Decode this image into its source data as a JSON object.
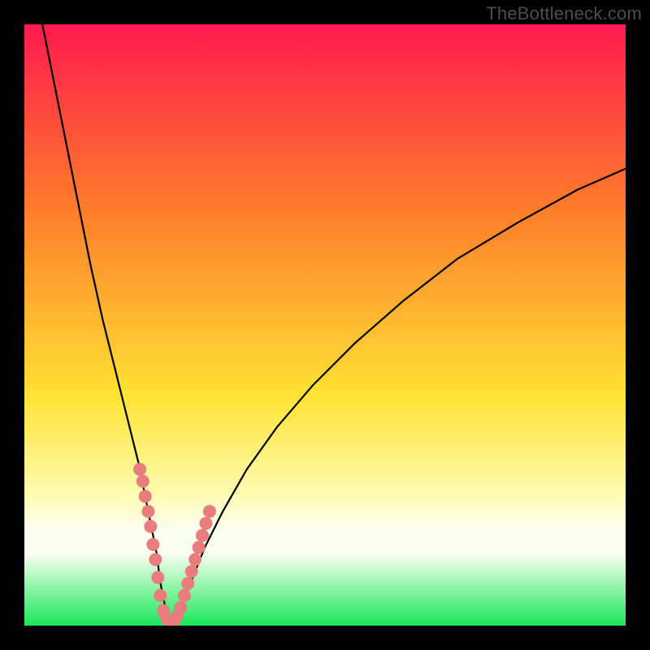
{
  "attribution": "TheBottleneck.com",
  "colors": {
    "frame": "#000000",
    "gradient_top": "#ff1a4f",
    "gradient_mid_upper": "#ff7a2a",
    "gradient_mid": "#ffe334",
    "gradient_lower": "#fffcb0",
    "gradient_band": "#fbfff0",
    "gradient_bottom": "#18e858",
    "curve": "#000000",
    "markers": "#e97c7c"
  },
  "chart_data": {
    "type": "line",
    "title": "",
    "xlabel": "",
    "ylabel": "",
    "xlim": [
      0,
      100
    ],
    "ylim": [
      0,
      100
    ],
    "series": [
      {
        "name": "bottleneck-curve",
        "x": [
          3,
          5,
          7,
          9,
          11,
          13,
          15,
          17,
          19,
          20,
          21,
          22,
          22.5,
          23,
          23.7,
          24.5,
          26,
          28,
          30,
          33,
          37,
          42,
          48,
          55,
          63,
          72,
          82,
          92,
          100
        ],
        "values": [
          100,
          90,
          80,
          70,
          60,
          51,
          43,
          35,
          27,
          22,
          17,
          12,
          8,
          5,
          2,
          0.5,
          3,
          8,
          13,
          19,
          26,
          33,
          40,
          47,
          54,
          61,
          67,
          72.5,
          76
        ]
      }
    ],
    "markers": [
      {
        "name": "left-cluster",
        "x": [
          19.2,
          19.7,
          20.1,
          20.6,
          21.0,
          21.4,
          21.8,
          22.2,
          22.6
        ],
        "values": [
          26,
          24,
          21.5,
          19,
          16.5,
          13.5,
          11,
          8,
          5
        ]
      },
      {
        "name": "bottom-cluster",
        "x": [
          23.1,
          23.6,
          24.2,
          24.8,
          25.4
        ],
        "values": [
          2.5,
          1.2,
          0.6,
          0.6,
          1.5
        ]
      },
      {
        "name": "right-cluster",
        "x": [
          26.0,
          26.6,
          27.2,
          27.8,
          28.4,
          29.0,
          29.6,
          30.2,
          30.8
        ],
        "values": [
          3,
          5,
          7,
          9,
          11,
          13,
          15,
          17,
          19
        ]
      }
    ],
    "gradient_stops_pct": [
      0,
      30,
      62,
      78,
      84,
      88,
      100
    ]
  }
}
